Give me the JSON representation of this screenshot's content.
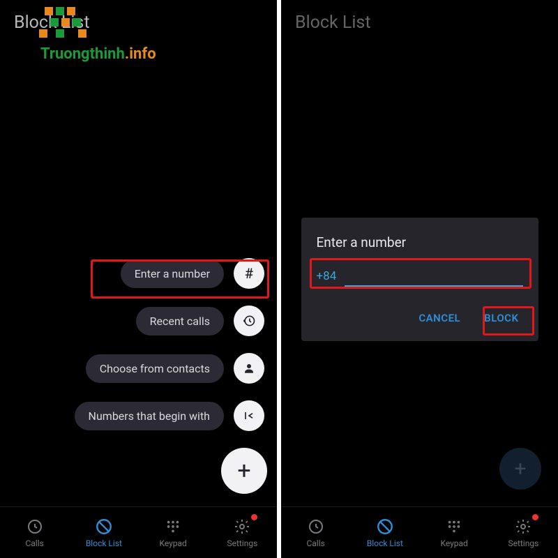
{
  "watermark": {
    "text1": "Truongthinh",
    "text2": ".info"
  },
  "left": {
    "title": "Block List",
    "options": {
      "enter_number": "Enter a number",
      "recent_calls": "Recent calls",
      "choose_contacts": "Choose from contacts",
      "begin_with": "Numbers that begin with"
    },
    "icons": {
      "hash": "#",
      "plus": "+"
    },
    "nav": {
      "calls": "Calls",
      "blocklist": "Block List",
      "keypad": "Keypad",
      "settings": "Settings"
    }
  },
  "right": {
    "title": "Block List",
    "dialog": {
      "title": "Enter a number",
      "prefix": "+84",
      "value": "",
      "cancel": "CANCEL",
      "block": "BLOCK"
    },
    "nav": {
      "calls": "Calls",
      "blocklist": "Block List",
      "keypad": "Keypad",
      "settings": "Settings"
    },
    "icons": {
      "plus": "+"
    }
  }
}
